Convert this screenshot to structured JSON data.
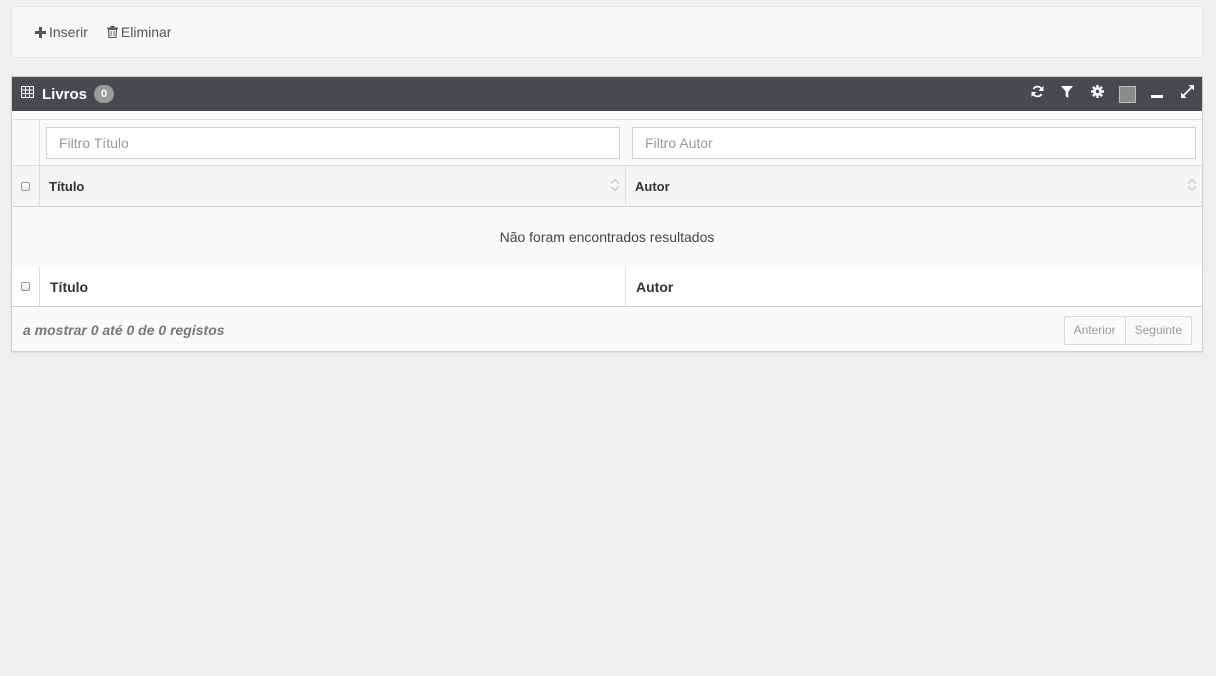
{
  "toolbar": {
    "insert_label": "Inserir",
    "delete_label": "Eliminar"
  },
  "widget": {
    "title": "Livros",
    "count": "0",
    "swatch_color": "#8a8a8a",
    "header_bg": "#474a4e",
    "tools": [
      "refresh-icon",
      "filter-icon",
      "gear-icon",
      "color-swatch",
      "minimize-icon",
      "fullscreen-icon"
    ]
  },
  "table": {
    "filters": {
      "title_placeholder": "Filtro Título",
      "author_placeholder": "Filtro Autor"
    },
    "columns": [
      "Título",
      "Autor"
    ],
    "footer_columns": [
      "Título",
      "Autor"
    ],
    "empty_message": "Não foram encontrados resultados"
  },
  "pagination": {
    "info": "a mostrar 0 até 0 de 0 registos",
    "prev_label": "Anterior",
    "next_label": "Seguinte"
  }
}
